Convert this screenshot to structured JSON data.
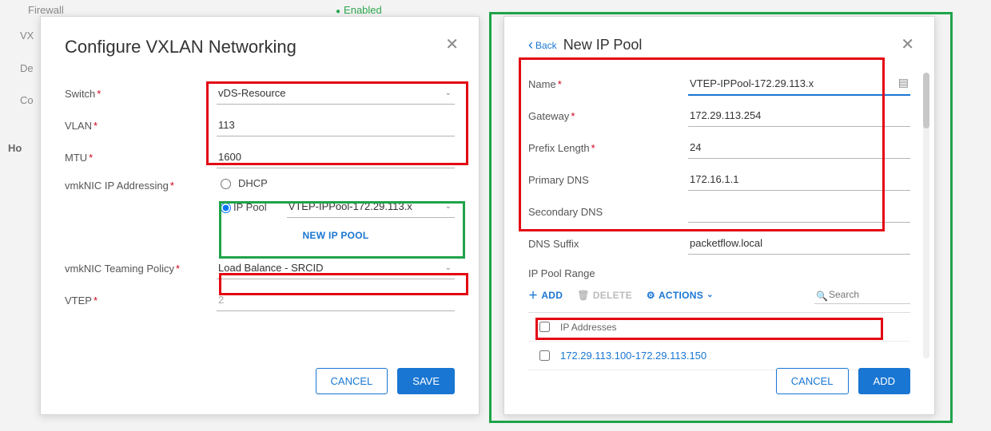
{
  "background": {
    "row1_label": "Firewall",
    "row1_status": "Enabled",
    "row2_label_frag": "VX",
    "row3_label_frag": "De",
    "row4_label_frag": "Co",
    "row5_label_frag": "Ho"
  },
  "left_modal": {
    "title": "Configure VXLAN Networking",
    "labels": {
      "switch": "Switch",
      "vlan": "VLAN",
      "mtu": "MTU",
      "ip_addressing": "vmkNIC IP Addressing",
      "teaming": "vmkNIC Teaming Policy",
      "vtep": "VTEP"
    },
    "values": {
      "switch": "vDS-Resource",
      "vlan": "113",
      "mtu": "1600",
      "dhcp_label": "DHCP",
      "ippool_label": "IP Pool",
      "ippool_selected": "VTEP-IPPool-172.29.113.x",
      "new_ip_pool": "NEW IP POOL",
      "teaming": "Load Balance - SRCID",
      "vtep": "2"
    },
    "buttons": {
      "cancel": "CANCEL",
      "save": "SAVE"
    }
  },
  "right_modal": {
    "back": "Back",
    "title": "New IP Pool",
    "labels": {
      "name": "Name",
      "gateway": "Gateway",
      "prefix": "Prefix Length",
      "pdns": "Primary DNS",
      "sdns": "Secondary DNS",
      "suffix": "DNS Suffix",
      "section": "IP Pool Range"
    },
    "values": {
      "name": "VTEP-IPPool-172.29.113.x",
      "gateway": "172.29.113.254",
      "prefix": "24",
      "pdns": "172.16.1.1",
      "sdns": "",
      "suffix": "packetflow.local"
    },
    "toolbar": {
      "add": "ADD",
      "delete": "DELETE",
      "actions": "ACTIONS",
      "search_placeholder": "Search"
    },
    "grid": {
      "header": "IP Addresses",
      "rows": [
        "172.29.113.100-172.29.113.150"
      ]
    },
    "buttons": {
      "cancel": "CANCEL",
      "add": "ADD"
    }
  }
}
